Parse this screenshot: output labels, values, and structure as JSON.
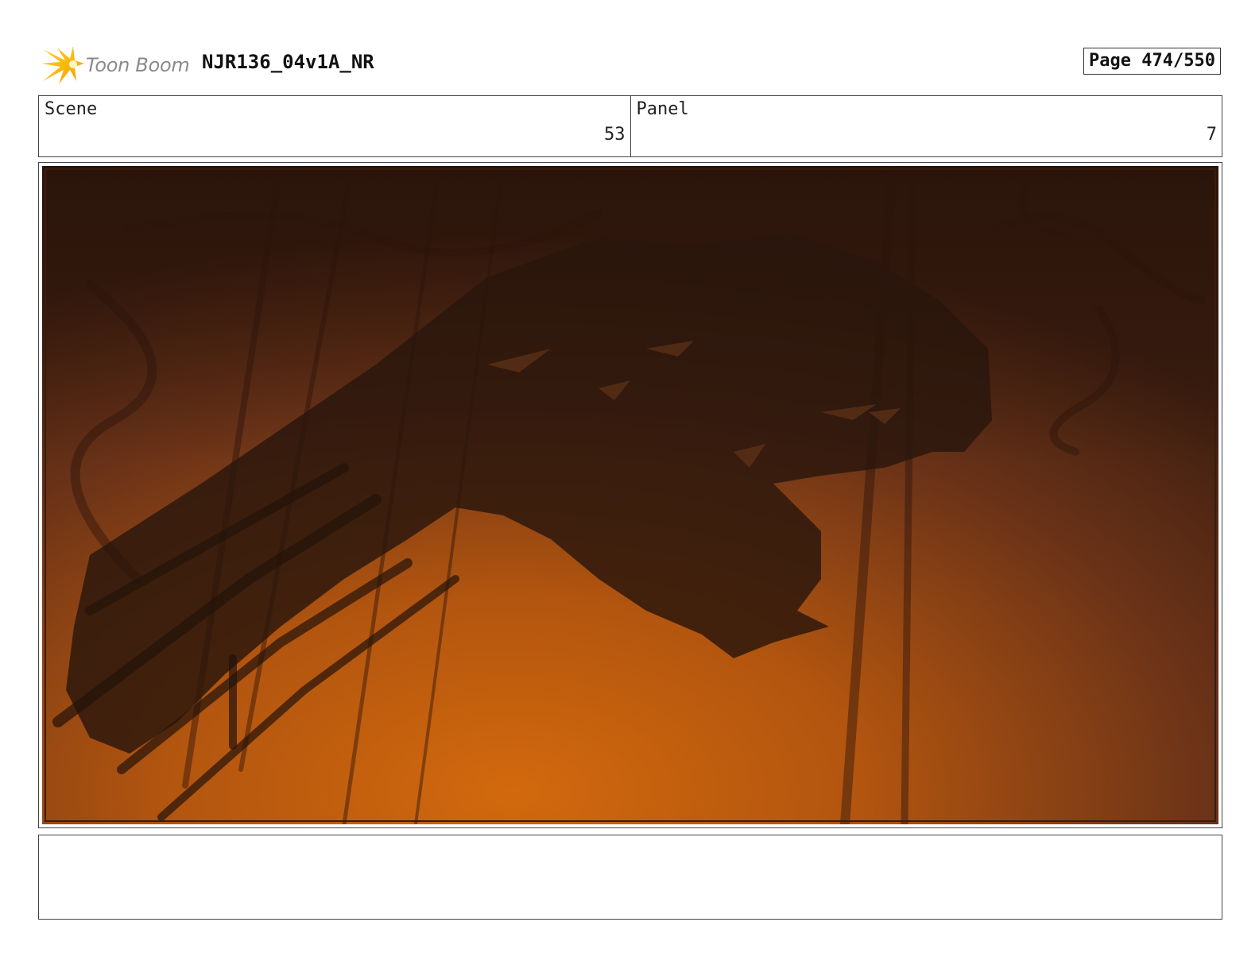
{
  "header": {
    "logo": {
      "icon": "toon-boom-star-logo-icon",
      "text": "Toon Boom"
    },
    "title": "NJR136_04v1A_NR",
    "page_label": "Page 474/550"
  },
  "info": {
    "scene": {
      "label": "Scene",
      "value": "53"
    },
    "panel": {
      "label": "Panel",
      "value": "7"
    }
  },
  "panel_image": {
    "description_icon": "storyboard-sketch-image",
    "palette": {
      "sky_top": "#3a1d10",
      "glow": "#d2690e",
      "silhouette": "#2a160c"
    }
  },
  "notes": {
    "text": ""
  }
}
